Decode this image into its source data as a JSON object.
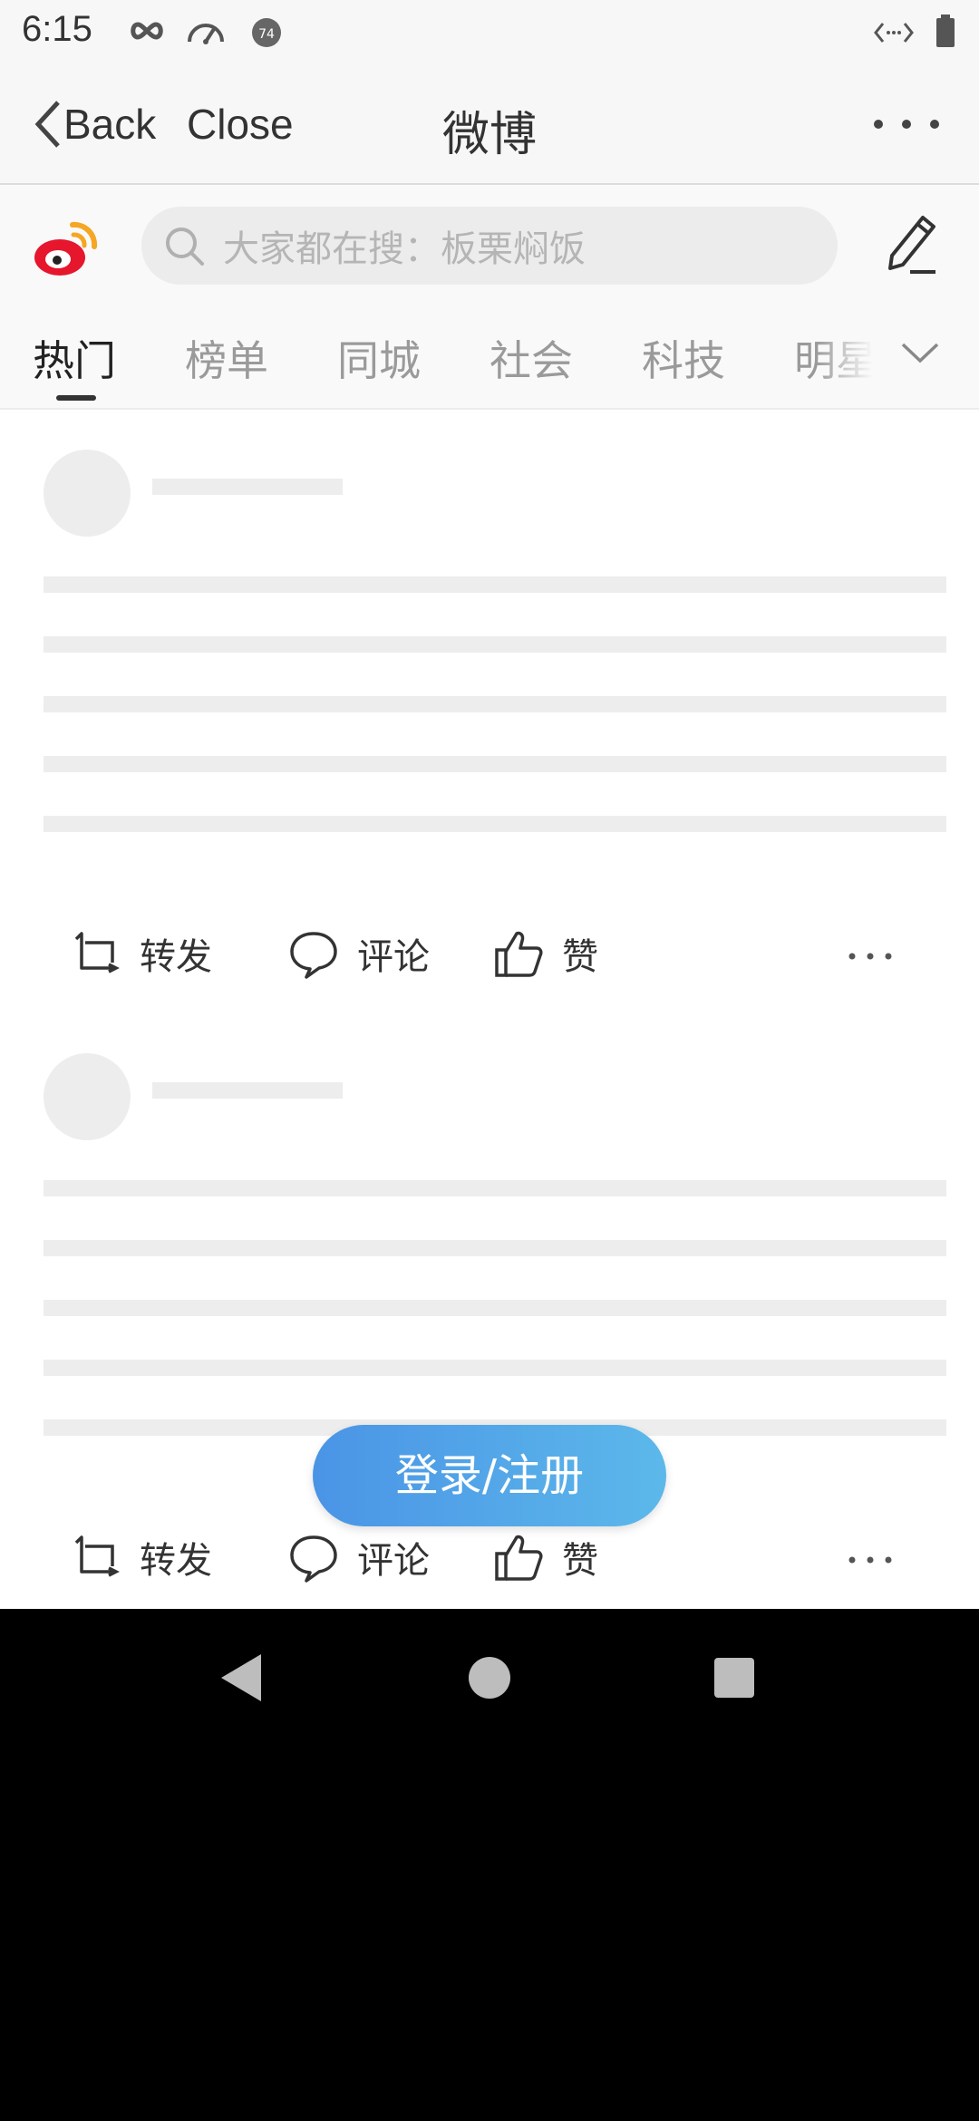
{
  "status_bar": {
    "time": "6:15",
    "badge_number": "74",
    "icons": [
      "infinity-icon",
      "speedometer-icon",
      "circle-badge-icon",
      "code-brackets-icon",
      "battery-icon"
    ]
  },
  "nav": {
    "back_label": "Back",
    "close_label": "Close",
    "title": "微博"
  },
  "search": {
    "placeholder": "大家都在搜：板栗焖饭"
  },
  "tabs": [
    {
      "label": "热门",
      "active": true
    },
    {
      "label": "榜单",
      "active": false
    },
    {
      "label": "同城",
      "active": false
    },
    {
      "label": "社会",
      "active": false
    },
    {
      "label": "科技",
      "active": false
    },
    {
      "label": "明星",
      "active": false
    }
  ],
  "post_actions": {
    "repost": "转发",
    "comment": "评论",
    "like": "赞"
  },
  "login_button": "登录/注册",
  "colors": {
    "accent_blue_start": "#4a94e6",
    "accent_blue_end": "#5cb8ea",
    "weibo_red": "#e6162d",
    "weibo_orange": "#f5a623",
    "skeleton": "#ededed"
  }
}
